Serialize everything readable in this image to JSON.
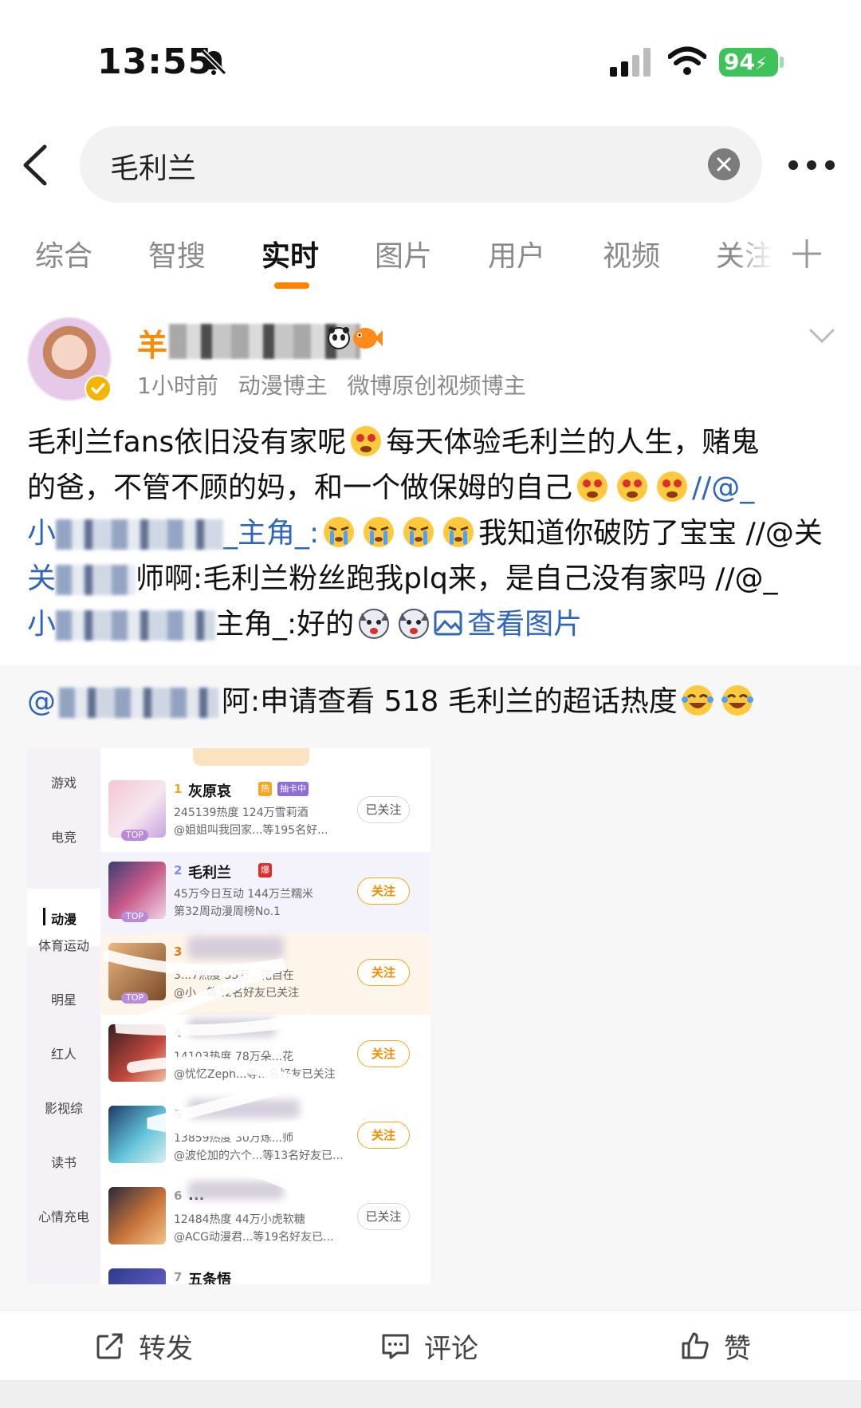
{
  "status_bar": {
    "time": "13:55",
    "battery": "94"
  },
  "search": {
    "query": "毛利兰"
  },
  "tabs": [
    {
      "label": "综合"
    },
    {
      "label": "智搜"
    },
    {
      "label": "实时"
    },
    {
      "label": "图片"
    },
    {
      "label": "用户"
    },
    {
      "label": "视频"
    },
    {
      "label": "关注"
    }
  ],
  "post": {
    "username_prefix": "羊",
    "time_ago": "1小时前",
    "tags": [
      "动漫博主",
      "微博原创视频博主"
    ],
    "lines": [
      {
        "a": "毛利兰fans依旧没有家呢",
        "b": "每天体验毛利兰的人生，赌鬼"
      },
      {
        "a": "的爸，不管不顾的妈，和一个做保姆的自己",
        "b": "//@_"
      },
      {
        "a": "小",
        "b": "_主角_:",
        "c": "我知道你破防了宝宝 //@关"
      },
      {
        "a": "关",
        "b": "师啊:毛利兰粉丝跑我plq来，是自己没有家吗 //@_"
      },
      {
        "a": "小",
        "b": "主角_:好的",
        "c": "查看图片"
      }
    ]
  },
  "repost": {
    "prefix": "@",
    "text": "阿:申请查看 518 毛利兰的超话热度",
    "image": {
      "categories": [
        "游戏",
        "电竞",
        "动漫",
        "体育运动",
        "明星",
        "红人",
        "影视综",
        "读书",
        "心情充电"
      ],
      "rows": [
        {
          "rank": "1",
          "name": "灰原哀",
          "tag1": "热",
          "tag2": "抽卡中",
          "line1": "245139热度 124万雪莉酒",
          "line2": "@姐姐叫我回家...等195名好...",
          "button": "已关注"
        },
        {
          "rank": "2",
          "name": "毛利兰",
          "tag1": "爆",
          "line1": "45万今日互动 144万兰糯米",
          "line2": "第32周动漫周榜No.1",
          "button": "关注"
        },
        {
          "rank": "3",
          "name": "",
          "line1": "3...7热度 55万...花自在",
          "line2": "@小...等12名好友已关注",
          "button": "关注"
        },
        {
          "rank": "4",
          "name": "",
          "line1": "14103热度 78万朵...花",
          "line2": "@忧忆Zeph...等...名好友已关注",
          "button": "关注"
        },
        {
          "rank": "5",
          "name": "",
          "line1": "13859热度 30万炼...师",
          "line2": "@波伦加的六个...等13名好友已...",
          "button": "关注"
        },
        {
          "rank": "6",
          "name": "...",
          "line1": "12484热度 44万小虎软糖",
          "line2": "@ACG动漫君...等19名好友已...",
          "button": "已关注"
        },
        {
          "rank": "7",
          "name": "五条悟",
          "line1": "",
          "line2": "",
          "button": ""
        }
      ],
      "top_badge": "TOP"
    }
  },
  "actions": {
    "repost": "转发",
    "comment": "评论",
    "like": "赞"
  }
}
